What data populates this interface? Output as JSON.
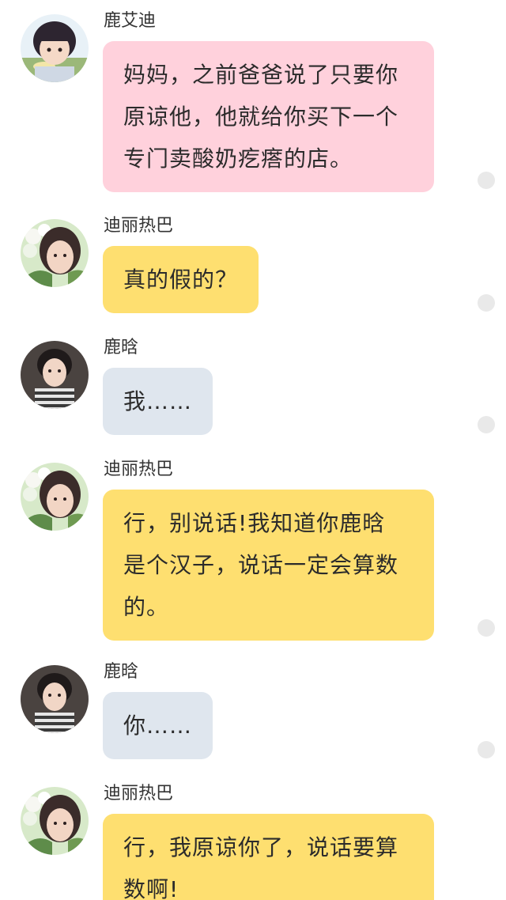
{
  "messages": [
    {
      "sender": "鹿艾迪",
      "avatar_icon": "child-avatar-icon",
      "style": "pink",
      "lines": [
        "妈妈，之前爸爸说了只要你",
        "原谅他，他就给你买下一个",
        "专门卖酸奶疙瘩的店。"
      ]
    },
    {
      "sender": "迪丽热巴",
      "avatar_icon": "woman-avatar-icon",
      "style": "yellow",
      "lines": [
        "真的假的？"
      ]
    },
    {
      "sender": "鹿晗",
      "avatar_icon": "man-avatar-icon",
      "style": "gray",
      "lines": [
        "我……"
      ]
    },
    {
      "sender": "迪丽热巴",
      "avatar_icon": "woman-avatar-icon",
      "style": "yellow",
      "lines": [
        "行，别说话!我知道你鹿晗",
        "是个汉子，说话一定会算数",
        "的。"
      ]
    },
    {
      "sender": "鹿晗",
      "avatar_icon": "man-avatar-icon",
      "style": "gray",
      "lines": [
        "你……"
      ]
    },
    {
      "sender": "迪丽热巴",
      "avatar_icon": "woman-avatar-icon",
      "style": "yellow",
      "lines": [
        "行，我原谅你了，说话要算",
        "数啊!"
      ]
    }
  ],
  "colors": {
    "pink_bubble": "#ffd1dc",
    "yellow_bubble": "#fedf70",
    "gray_bubble": "#dfe6ee",
    "indicator_dot": "#e9e9e9"
  }
}
